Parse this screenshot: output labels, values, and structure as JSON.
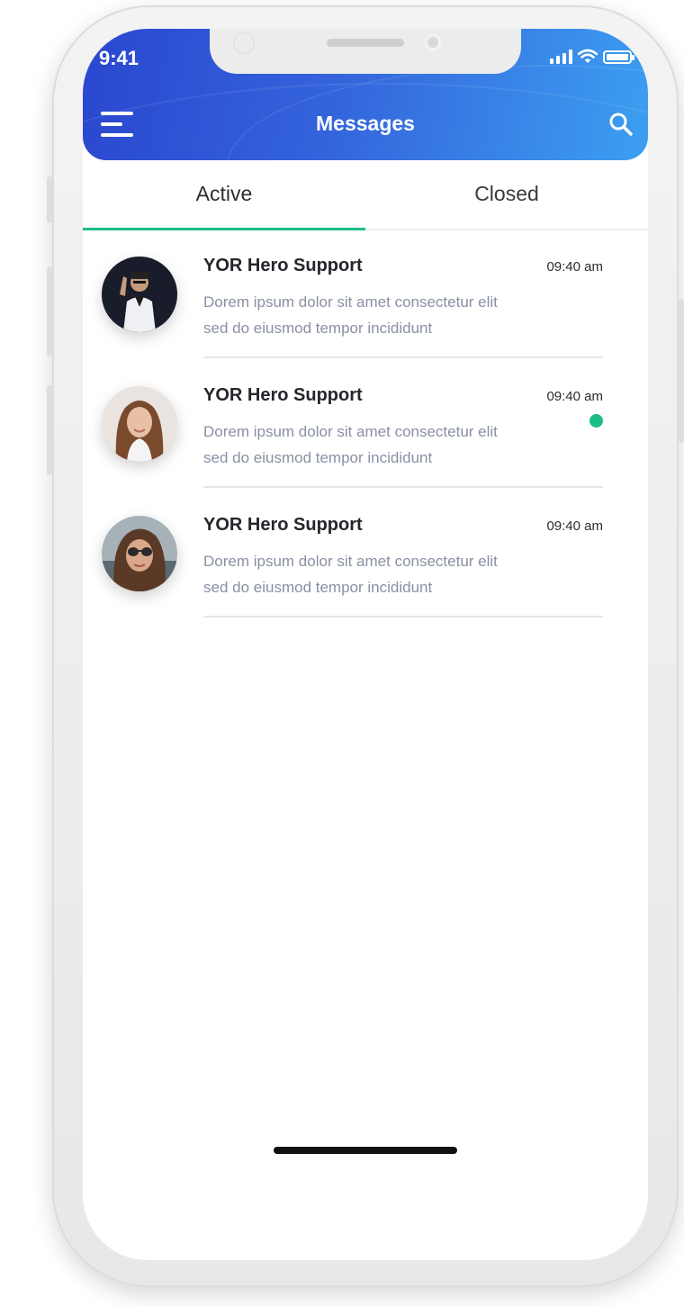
{
  "status_bar": {
    "time": "9:41"
  },
  "header": {
    "title": "Messages"
  },
  "tabs": [
    {
      "label": "Active",
      "selected": true
    },
    {
      "label": "Closed",
      "selected": false
    }
  ],
  "messages": [
    {
      "name": "YOR Hero Support",
      "time": "09:40 am",
      "preview_line1": "Dorem ipsum dolor sit amet consectetur elit",
      "preview_line2": "sed do eiusmod tempor incididunt",
      "unread": false
    },
    {
      "name": "YOR Hero Support",
      "time": "09:40 am",
      "preview_line1": "Dorem ipsum dolor sit amet consectetur elit",
      "preview_line2": "sed do eiusmod tempor incididunt",
      "unread": true
    },
    {
      "name": "YOR Hero Support",
      "time": "09:40 am",
      "preview_line1": "Dorem ipsum dolor sit amet consectetur elit",
      "preview_line2": "sed do eiusmod tempor incididunt",
      "unread": false
    }
  ],
  "colors": {
    "header_gradient_start": "#2a47cf",
    "header_gradient_end": "#3c9ff0",
    "accent_green": "#1dbd8a",
    "preview_text": "#8990a3"
  },
  "icons": {
    "menu": "hamburger-menu-icon",
    "search": "search-icon",
    "signal": "cellular-signal-icon",
    "wifi": "wifi-icon",
    "battery": "battery-icon"
  }
}
